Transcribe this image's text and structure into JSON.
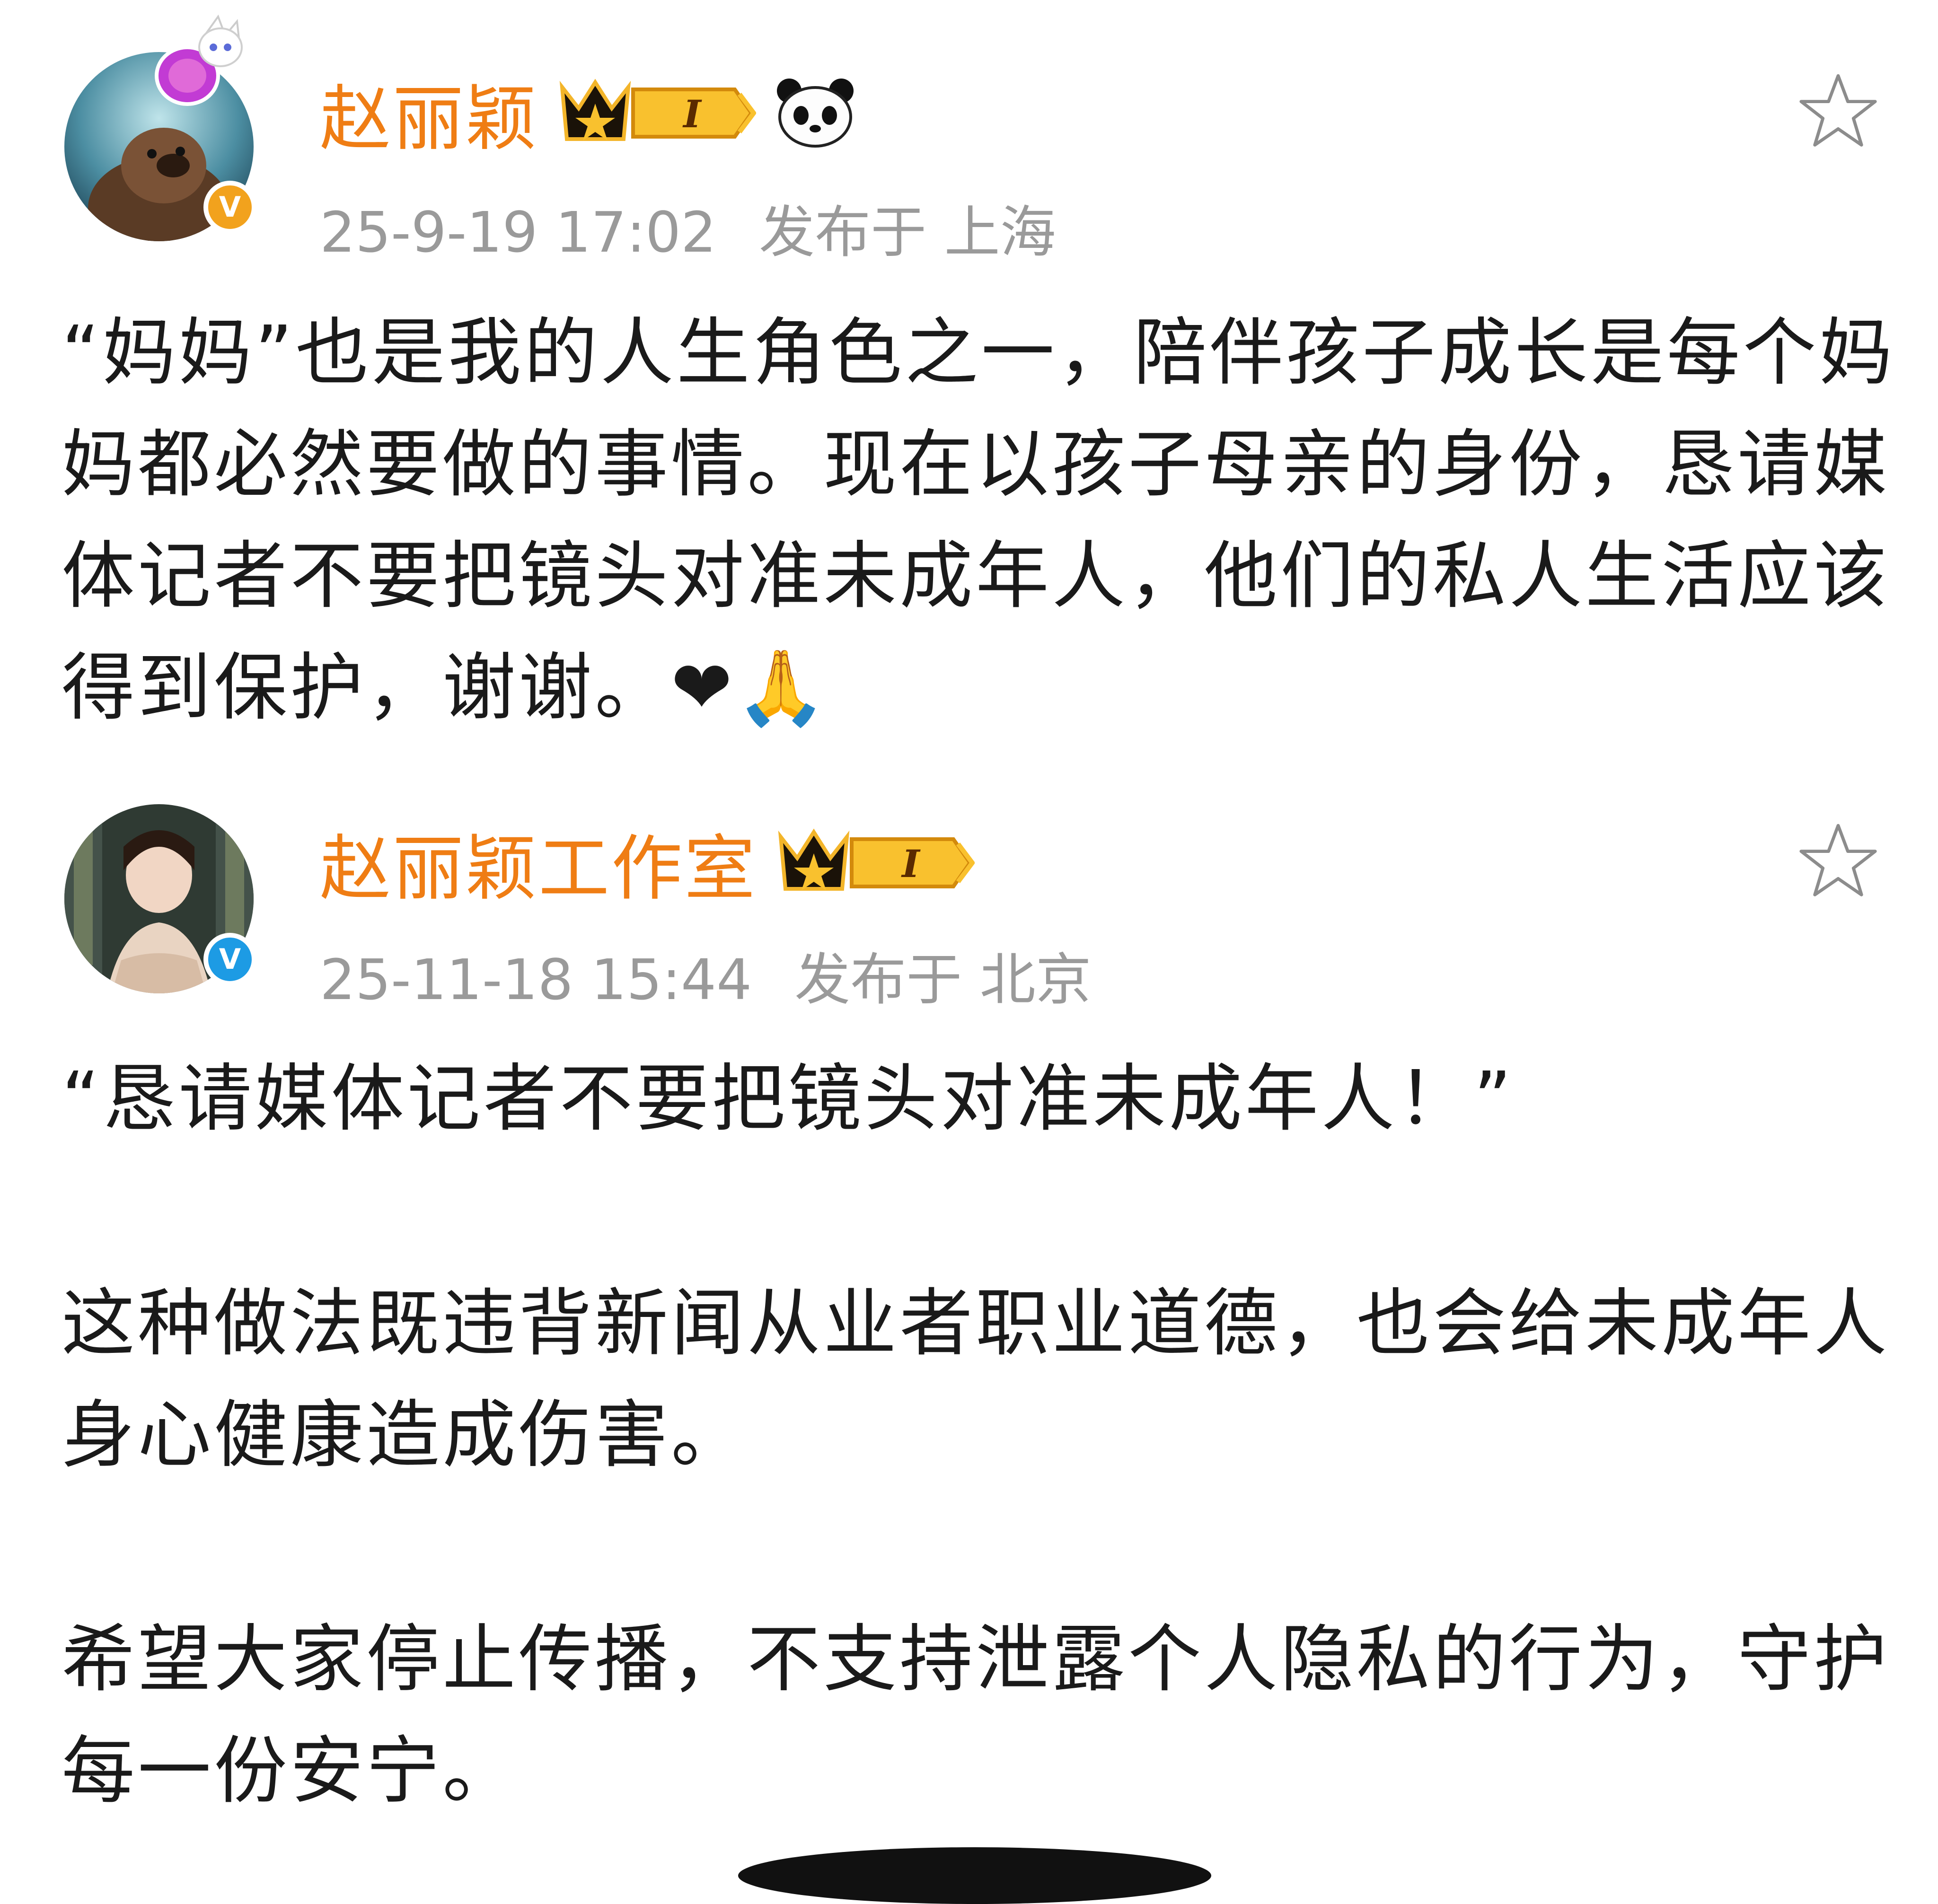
{
  "posts": [
    {
      "author": "赵丽颖",
      "level_badge": "I",
      "verify_badge": "V",
      "verify_color": "#f2a21d",
      "timestamp": "25-9-19 17:02",
      "location": "发布于 上海",
      "text": "“妈妈”也是我的人生角色之一，陪伴孩子成长是每个妈妈都必然要做的事情。现在以孩子母亲的身份，恳请媒体记者不要把镜头对准未成年人，他们的私人生活应该得到保护，谢谢。❤🙏",
      "icons": [
        "crown-level-badge",
        "panda-icon",
        "star-icon"
      ]
    },
    {
      "author": "赵丽颖工作室",
      "level_badge": "I",
      "verify_badge": "V",
      "verify_color": "#1d9be4",
      "timestamp": "25-11-18 15:44",
      "location": "发布于 北京",
      "paragraphs": [
        "“恳请媒体记者不要把镜头对准未成年人！”",
        "这种做法既违背新闻从业者职业道德，也会给未成年人身心健康造成伤害。",
        "希望大家停止传播，不支持泄露个人隐私的行为，守护每一份安宁。"
      ],
      "icons": [
        "crown-level-badge",
        "star-icon"
      ]
    }
  ],
  "colors": {
    "username": "#ef7d14",
    "meta": "#9a9a9a",
    "text": "#1a1a1a"
  }
}
